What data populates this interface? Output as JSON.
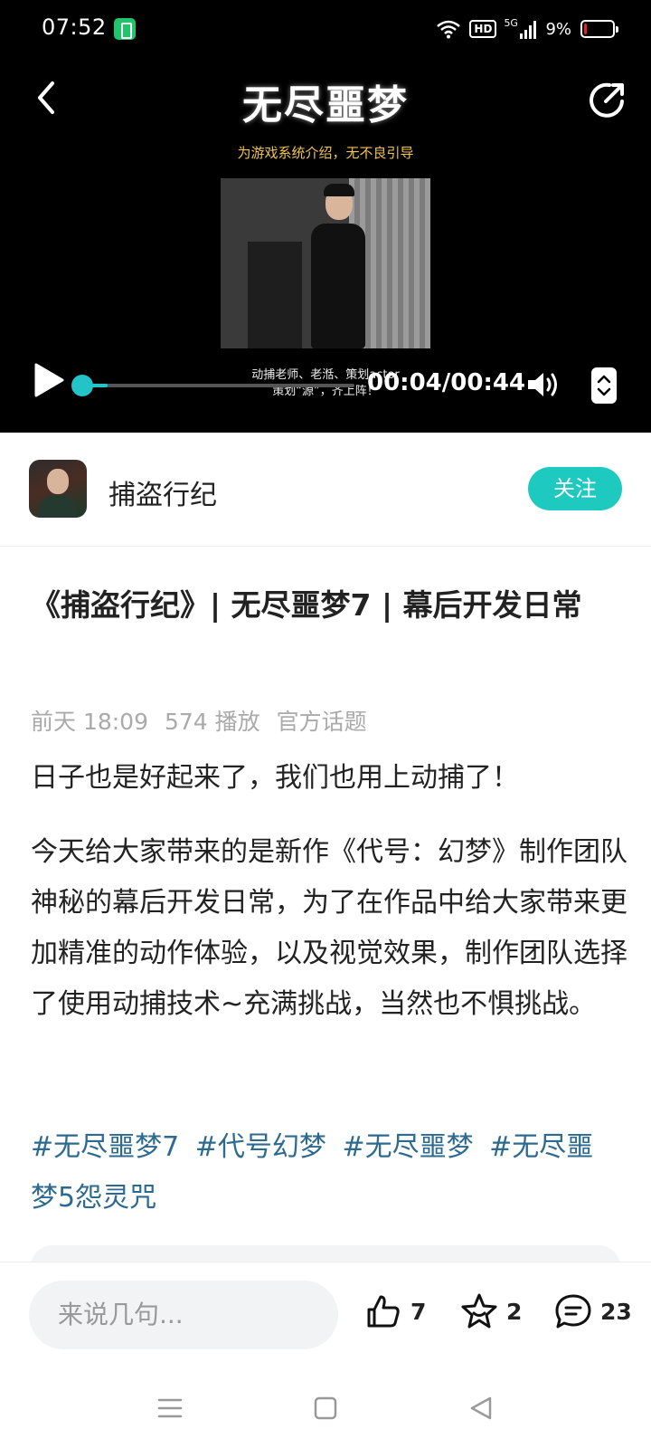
{
  "status_bar": {
    "time": "07:52",
    "network_badge": "HD",
    "signal_label": "5G",
    "battery_percent": "9%",
    "battery_level": 0.09,
    "battery_color": "#e0242a"
  },
  "video": {
    "title": "无尽噩梦",
    "subtitle": "为游戏系统介绍，无不良引导",
    "caption_line1": "动捕老师、老湉、策划actor",
    "caption_line2": "策划“源”，齐上阵！",
    "time_readout": "00:04/00:44",
    "progress": 0.09,
    "accent_color": "#22c4c8"
  },
  "author": {
    "name": "捕盗行纪",
    "follow_label": "关注",
    "follow_color": "#1ec9c0"
  },
  "article": {
    "title": "《捕盗行纪》| 无尽噩梦7 | 幕后开发日常",
    "meta_time": "前天 18:09",
    "meta_plays": "574 播放",
    "meta_topic": "官方话题",
    "paragraph1": "日子也是好起来了，我们也用上动捕了！",
    "paragraph2": "今天给大家带来的是新作《代号：幻梦》制作团队神秘的幕后开发日常，为了在作品中给大家带来更加精准的动作体验，以及视觉效果，制作团队选择了使用动捕技术~充满挑战，当然也不惧挑战。",
    "tags": [
      "#无尽噩梦7",
      "#代号幻梦",
      "#无尽噩梦",
      "#无尽噩梦5怨灵咒"
    ],
    "tag_color": "#2c6a8f"
  },
  "actions": {
    "comment_placeholder": "来说几句...",
    "like_count": "7",
    "favorite_count": "2",
    "comment_count": "23"
  },
  "icons": {
    "back": "chevron-left-icon",
    "share": "share-icon",
    "play": "play-icon",
    "volume": "volume-icon",
    "fullscreen": "fullscreen-icon",
    "like": "thumbs-up-icon",
    "favorite": "star-icon",
    "comment": "comment-bubble-icon",
    "sys_menu": "menu-icon",
    "sys_home": "home-square-icon",
    "sys_back": "back-triangle-icon"
  }
}
